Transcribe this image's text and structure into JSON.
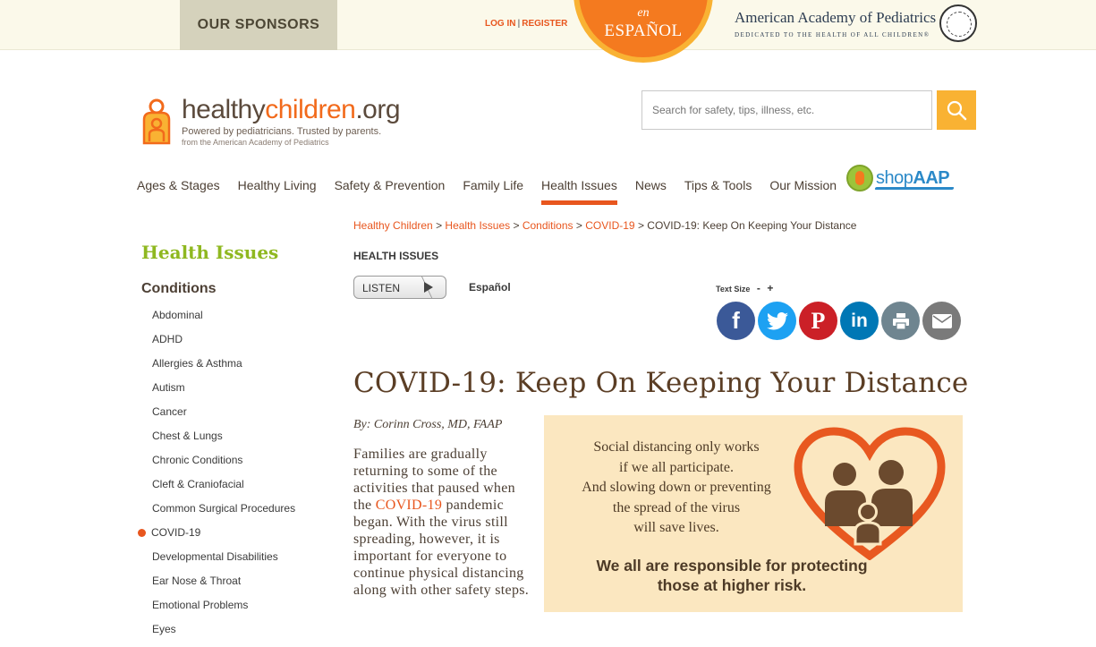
{
  "topbar": {
    "sponsors": "OUR SPONSORS",
    "login": "LOG IN",
    "register": "REGISTER",
    "lang_en": "en",
    "lang_espanol": "ESPAÑOL",
    "aap_name": "American Academy of Pediatrics",
    "aap_tagline": "DEDICATED TO THE HEALTH OF ALL CHILDREN®"
  },
  "logo": {
    "main": "healthy",
    "main2": "children",
    "org": ".org",
    "tagline": "Powered by pediatricians. Trusted by parents.",
    "tagline2": "from the American Academy of Pediatrics"
  },
  "search": {
    "placeholder": "Search for safety, tips, illness, etc."
  },
  "nav": {
    "items": [
      "Ages & Stages",
      "Healthy Living",
      "Safety & Prevention",
      "Family Life",
      "Health Issues",
      "News",
      "Tips & Tools",
      "Our Mission"
    ],
    "shop_pre": "shop",
    "shop_post": "AAP"
  },
  "sidebar": {
    "title": "Health Issues",
    "subtitle": "Conditions",
    "items": [
      "Abdominal",
      "ADHD",
      "Allergies & Asthma",
      "Autism",
      "Cancer",
      "Chest & Lungs",
      "Chronic Conditions",
      "Cleft & Craniofacial",
      "Common Surgical Procedures",
      "COVID-19",
      "Developmental Disabilities",
      "Ear Nose & Throat",
      "Emotional Problems",
      "Eyes"
    ]
  },
  "breadcrumb": {
    "c1": "Healthy Children",
    "c2": "Health Issues",
    "c3": "Conditions",
    "c4": "COVID-19",
    "current": "COVID-19: Keep On Keeping Your Distance",
    "sep": ">"
  },
  "article": {
    "section": "HEALTH ISSUES",
    "listen": "LISTEN",
    "espanol": "Español",
    "text_size": "Text Size",
    "minus": "-",
    "plus": "+",
    "title": "COVID-19: Keep On Keeping Your Distance",
    "byline": "By: Corinn Cross, MD, FAAP",
    "body_pre": "Families are gradually returning to some of the activities that paused when the ",
    "body_link": "COVID-19",
    "body_post": " pandemic began. With the virus still spreading, however, it is important for everyone to continue physical distancing along with other safety steps."
  },
  "share": {
    "facebook": "f",
    "pinterest": "P",
    "linkedin": "in"
  },
  "promo": {
    "line1": "Social distancing only works",
    "line2": "if we all participate.",
    "line3": "And slowing down or preventing",
    "line4": "the spread of the virus",
    "line5": "will save lives.",
    "line6": "We all are responsible for protecting",
    "line7": "those at higher risk."
  },
  "colors": {
    "accent": "#e8561e",
    "green": "#8fb820",
    "brown": "#5b3e25",
    "search_button": "#f9b233"
  }
}
